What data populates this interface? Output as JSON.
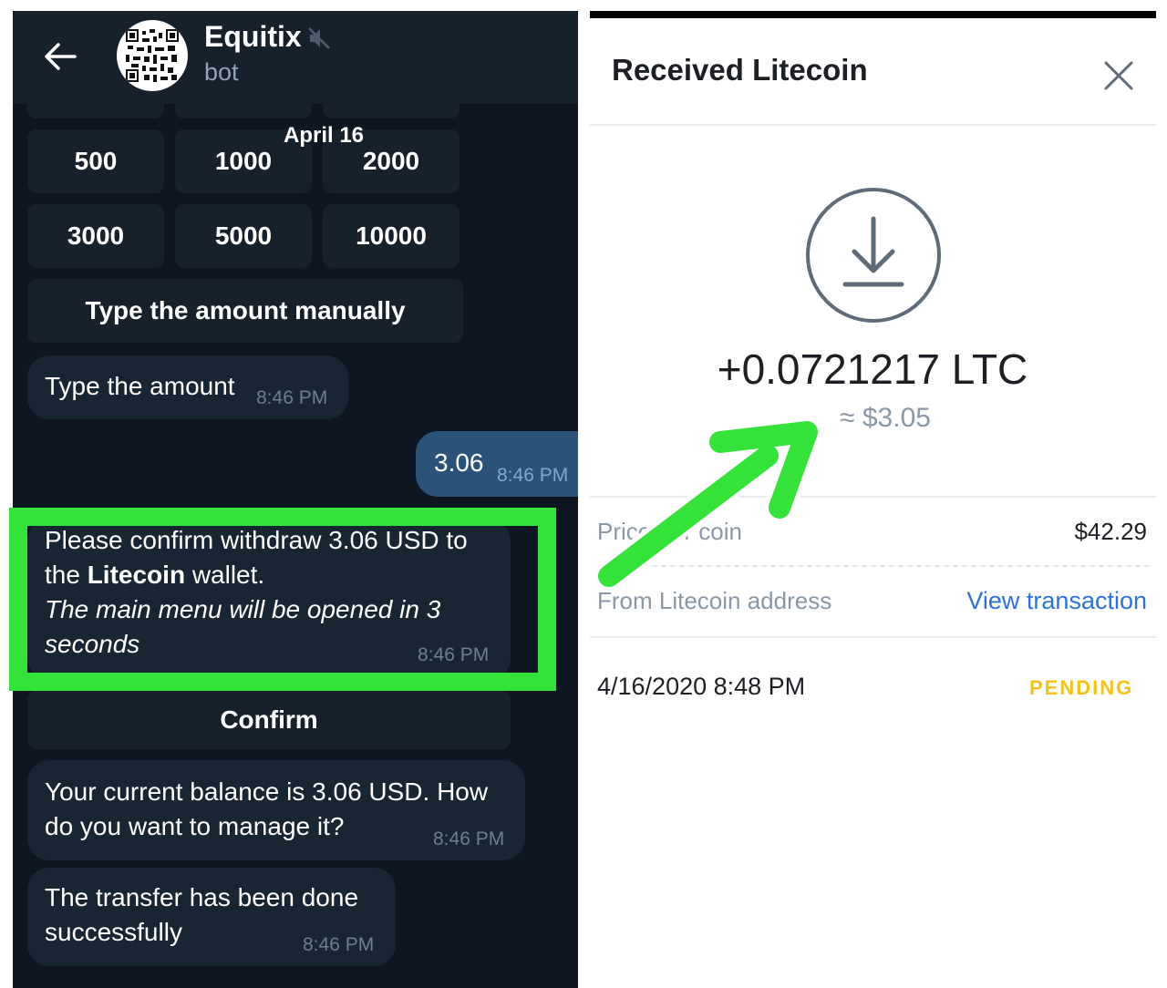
{
  "chat": {
    "bot_name": "Equitix",
    "bot_subtitle": "bot",
    "date_label": "April 16",
    "amount_buttons": [
      "500",
      "1000",
      "2000",
      "3000",
      "5000",
      "10000"
    ],
    "manual_button": "Type the amount manually",
    "msg_type_amount": {
      "text": "Type the amount",
      "time": "8:46 PM"
    },
    "msg_user_amount": {
      "text": "3.06",
      "time": "8:46 PM"
    },
    "msg_confirm": {
      "line1_pre": "Please confirm withdraw 3.06 USD to the ",
      "line1_bold": "Litecoin",
      "line1_post": " wallet.",
      "italic": "The main menu will be opened in 3 seconds",
      "time": "8:46 PM"
    },
    "confirm_button": "Confirm",
    "msg_balance": {
      "text": "Your current balance is 3.06 USD. How do you want to manage it?",
      "time": "8:46 PM"
    },
    "msg_transfer": {
      "text": "The transfer has been done successfully",
      "time": "8:46 PM"
    }
  },
  "wallet": {
    "title": "Received Litecoin",
    "amount_crypto": "+0.0721217 LTC",
    "amount_fiat": "≈ $3.05",
    "price_label": "Price per coin",
    "price_value": "$42.29",
    "from_label": "From Litecoin address",
    "view_tx": "View transaction",
    "date": "4/16/2020 8:48 PM",
    "status": "PENDING"
  },
  "colors": {
    "highlight": "#34e23a",
    "status_pending": "#f5c21b",
    "link": "#2b73d6",
    "chat_bg": "#0e1621",
    "bubble_out": "#2b5278"
  },
  "icons": [
    "back-arrow-icon",
    "qr-code-icon",
    "mute-icon",
    "close-icon",
    "download-icon"
  ]
}
